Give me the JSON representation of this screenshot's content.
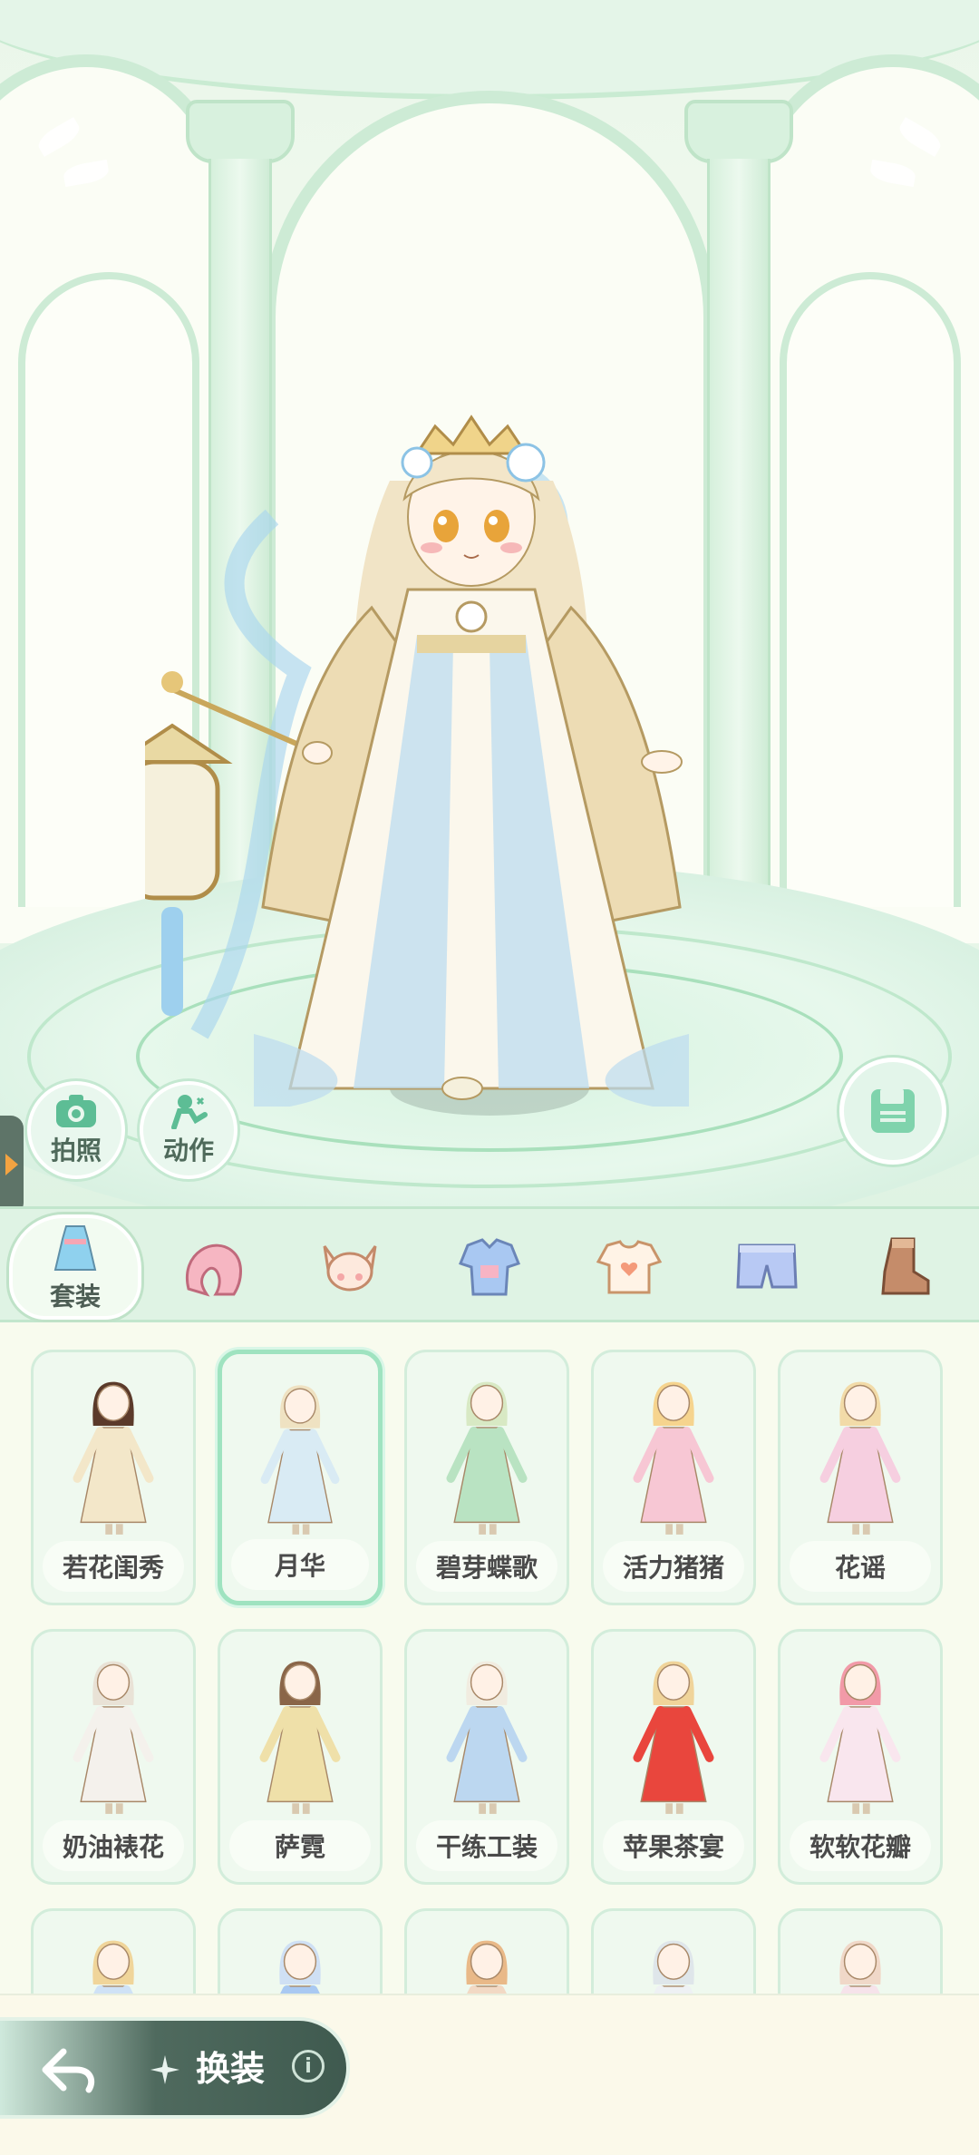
{
  "scene": {
    "photo_button": {
      "label": "拍照",
      "icon": "camera-icon"
    },
    "pose_button": {
      "label": "动作",
      "icon": "pose-icon"
    },
    "save_button": {
      "icon": "save-icon"
    }
  },
  "categories": [
    {
      "label": "套装",
      "icon": "dress-icon",
      "active": true
    },
    {
      "label": "",
      "icon": "hair-icon"
    },
    {
      "label": "",
      "icon": "face-icon"
    },
    {
      "label": "",
      "icon": "top-icon"
    },
    {
      "label": "",
      "icon": "shirt-icon"
    },
    {
      "label": "",
      "icon": "pants-icon"
    },
    {
      "label": "",
      "icon": "boots-icon"
    }
  ],
  "outfits": [
    {
      "name": "若花闺秀",
      "selected": false
    },
    {
      "name": "月华",
      "selected": true
    },
    {
      "name": "碧芽蝶歌",
      "selected": false
    },
    {
      "name": "活力猪猪",
      "selected": false
    },
    {
      "name": "花谣",
      "selected": false
    },
    {
      "name": "奶油裱花",
      "selected": false
    },
    {
      "name": "萨霓",
      "selected": false
    },
    {
      "name": "干练工装",
      "selected": false
    },
    {
      "name": "苹果茶宴",
      "selected": false
    },
    {
      "name": "软软花瓣",
      "selected": false
    },
    {
      "name": "",
      "selected": false
    },
    {
      "name": "",
      "selected": false
    },
    {
      "name": "",
      "selected": false
    },
    {
      "name": "",
      "selected": false
    },
    {
      "name": "",
      "selected": false
    }
  ],
  "footer": {
    "title": "换装",
    "back_icon": "back-arrow-icon",
    "info_glyph": "i"
  }
}
